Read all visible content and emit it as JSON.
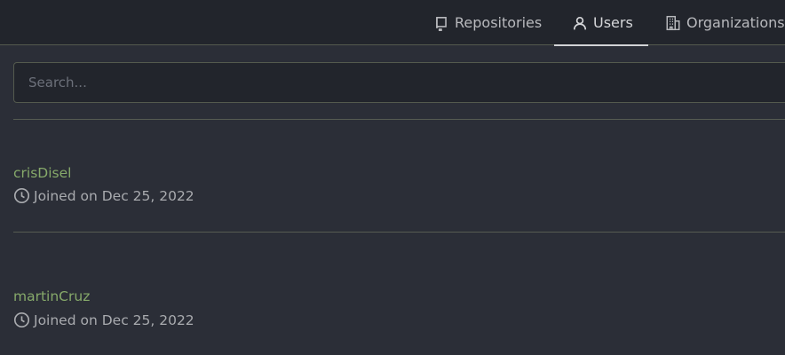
{
  "nav": {
    "tabs": [
      {
        "label": "Repositories",
        "icon": "repo-icon",
        "active": false
      },
      {
        "label": "Users",
        "icon": "user-icon",
        "active": true
      },
      {
        "label": "Organizations",
        "icon": "organization-icon",
        "active": false
      }
    ]
  },
  "search": {
    "placeholder": "Search...",
    "value": ""
  },
  "users": [
    {
      "name": "crisDisel",
      "joined": "Joined on Dec 25, 2022",
      "icon": "clock-icon"
    },
    {
      "name": "martinCruz",
      "joined": "Joined on Dec 25, 2022",
      "icon": "clock-icon"
    }
  ],
  "colors": {
    "background": "#2b2e37",
    "header_background": "#22252c",
    "username": "#86a96a",
    "border": "#545a4e"
  }
}
